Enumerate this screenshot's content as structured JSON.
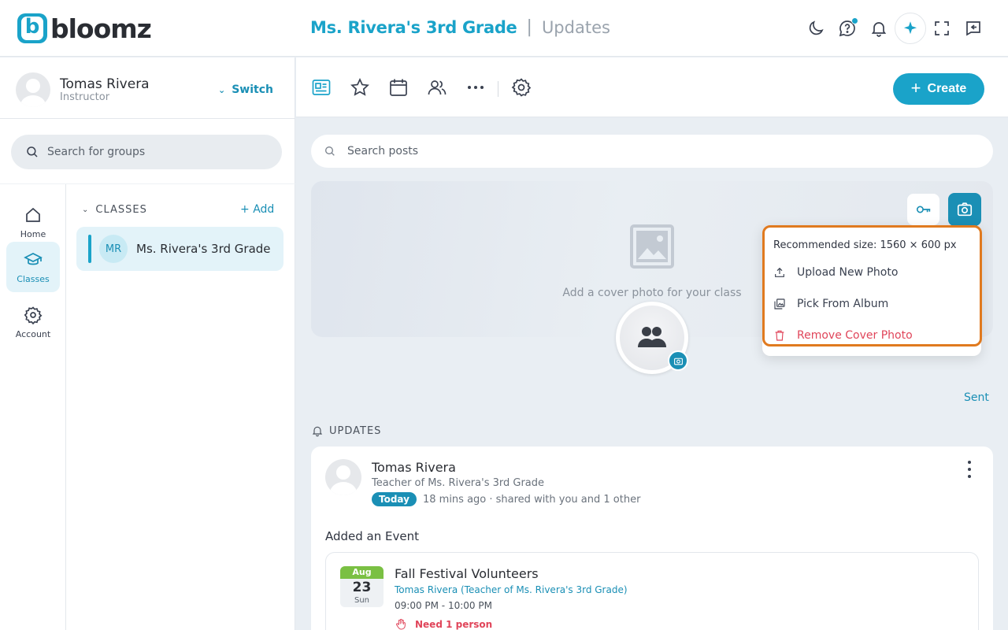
{
  "app": {
    "logo_text": "bloomz"
  },
  "header": {
    "class_name": "Ms. Rivera's 3rd Grade",
    "separator": "|",
    "section": "Updates"
  },
  "user": {
    "name": "Tomas Rivera",
    "role": "Instructor",
    "switch_label": "Switch"
  },
  "sidebar": {
    "search_placeholder": "Search for groups",
    "nav": [
      {
        "label": "Home",
        "icon": "home-icon"
      },
      {
        "label": "Classes",
        "icon": "graduation-cap-icon",
        "active": true
      },
      {
        "label": "Account",
        "icon": "gear-icon"
      }
    ],
    "classes_header": "CLASSES",
    "add_label": "Add",
    "classes": [
      {
        "initials": "MR",
        "name": "Ms. Rivera's 3rd Grade"
      }
    ]
  },
  "toolbar": {
    "tools": [
      "feed-icon",
      "star-icon",
      "calendar-icon",
      "people-icon",
      "more-icon",
      "settings-icon"
    ],
    "create_label": "Create"
  },
  "main": {
    "search_placeholder": "Search posts",
    "cover_text": "Add a cover photo for your class",
    "sent_label": "Sent",
    "updates_header": "UPDATES"
  },
  "cover_menu": {
    "hint": "Recommended size: 1560 × 600 px",
    "items": [
      {
        "label": "Upload New Photo",
        "icon": "upload-icon"
      },
      {
        "label": "Pick From Album",
        "icon": "album-icon"
      },
      {
        "label": "Remove Cover Photo",
        "icon": "trash-icon"
      }
    ]
  },
  "post": {
    "author": "Tomas Rivera",
    "subtitle": "Teacher of Ms. Rivera's 3rd Grade",
    "badge": "Today",
    "meta": "18 mins ago · shared with you and 1 other",
    "action": "Added an Event",
    "event": {
      "month": "Aug",
      "day": "23",
      "weekday": "Sun",
      "title": "Fall Festival Volunteers",
      "host": "Tomas Rivera (Teacher of Ms. Rivera's 3rd Grade)",
      "time": "09:00 PM - 10:00 PM",
      "need": "Need 1 person"
    }
  },
  "colors": {
    "accent": "#1aa3c9",
    "accent_dark": "#1a8fb5",
    "danger": "#e0455a",
    "highlight": "#e07a1f",
    "calendar_month": "#7ac043"
  }
}
